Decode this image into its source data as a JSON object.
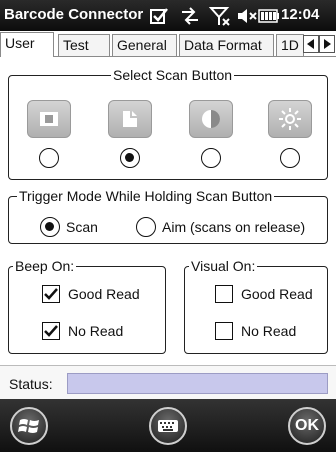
{
  "titlebar": {
    "title": "Barcode Connector",
    "clock": "12:04",
    "icons": [
      "checkbox-icon",
      "sync-icon",
      "no-signal-icon",
      "speaker-muted-icon",
      "battery-icon"
    ]
  },
  "tabs": [
    {
      "label": "User",
      "active": true
    },
    {
      "label": "Test",
      "active": false
    },
    {
      "label": "General",
      "active": false
    },
    {
      "label": "Data Format",
      "active": false
    },
    {
      "label": "1D",
      "active": false
    }
  ],
  "scan_button": {
    "legend": "Select Scan Button",
    "buttons": [
      {
        "icon": "scan-button-1-icon",
        "selected": false
      },
      {
        "icon": "scan-button-2-icon",
        "selected": true
      },
      {
        "icon": "scan-button-3-icon",
        "selected": false
      },
      {
        "icon": "scan-button-4-icon",
        "selected": false
      }
    ]
  },
  "trigger_mode": {
    "legend": "Trigger Mode While Holding Scan Button",
    "options": [
      {
        "label": "Scan",
        "selected": true
      },
      {
        "label": "Aim (scans on release)",
        "selected": false
      }
    ]
  },
  "beep_on": {
    "legend": "Beep On:",
    "items": [
      {
        "label": "Good Read",
        "checked": true
      },
      {
        "label": "No Read",
        "checked": true
      }
    ]
  },
  "visual_on": {
    "legend": "Visual On:",
    "items": [
      {
        "label": "Good Read",
        "checked": false
      },
      {
        "label": "No Read",
        "checked": false
      }
    ]
  },
  "status": {
    "label": "Status:",
    "value": ""
  },
  "bottombar": {
    "ok_label": "OK"
  },
  "colors": {
    "status_field": "#c8c8ec",
    "titlebar": "#111111"
  }
}
